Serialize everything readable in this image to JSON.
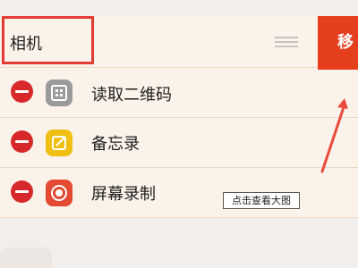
{
  "menu": {
    "items": [
      {
        "label": "相机"
      },
      {
        "label": "读取二维码"
      },
      {
        "label": "备忘录"
      },
      {
        "label": "屏幕录制"
      }
    ],
    "move_label": "移"
  },
  "tooltip": {
    "text": "点击查看大图"
  },
  "colors": {
    "panel_bg": "#fbf3ea",
    "accent_red": "#e63f1d",
    "delete_red": "#d7282b",
    "memo_yellow": "#efbf13",
    "record_red": "#e44931",
    "qr_gray": "#9a9a9a"
  },
  "icons": {
    "delete": "minus-circle-icon",
    "qr": "qr-scan-icon",
    "memo": "edit-note-icon",
    "record": "record-circle-icon",
    "drag": "drag-handle-icon",
    "arrow": "red-arrow-annotation-icon"
  }
}
